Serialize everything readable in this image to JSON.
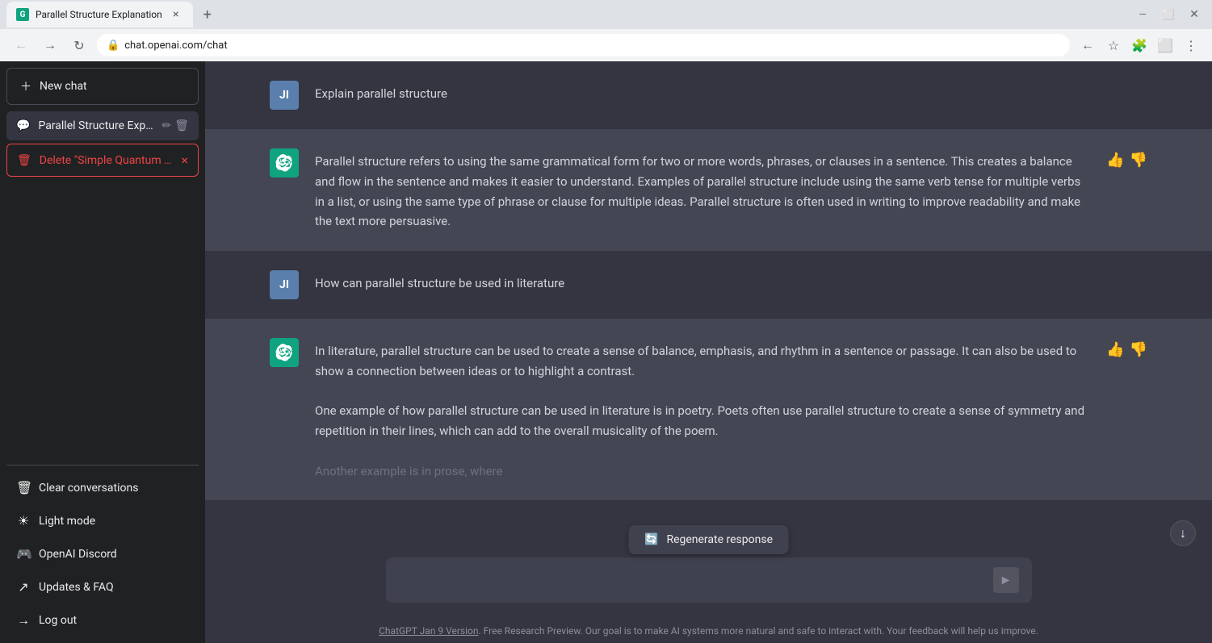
{
  "browser": {
    "tab_title": "Parallel Structure Explanation",
    "url": "chat.openai.com/chat"
  },
  "sidebar": {
    "new_chat_label": "New chat",
    "chat_history": [
      {
        "id": "parallel-structure",
        "title": "Parallel Structure Expla",
        "active": true
      }
    ],
    "delete_item": {
      "label": "Delete \"Simple Quantum Com",
      "close_icon": "×"
    },
    "bottom_items": [
      {
        "id": "clear",
        "icon": "🗑",
        "label": "Clear conversations"
      },
      {
        "id": "light-mode",
        "icon": "☀",
        "label": "Light mode"
      },
      {
        "id": "discord",
        "icon": "🎮",
        "label": "OpenAI Discord"
      },
      {
        "id": "faq",
        "icon": "↗",
        "label": "Updates & FAQ"
      },
      {
        "id": "logout",
        "icon": "→",
        "label": "Log out"
      }
    ]
  },
  "messages": [
    {
      "id": "msg1",
      "role": "user",
      "avatar_initials": "JI",
      "content": "Explain parallel structure"
    },
    {
      "id": "msg2",
      "role": "ai",
      "content": "Parallel structure refers to using the same grammatical form for two or more words, phrases, or clauses in a sentence. This creates a balance and flow in the sentence and makes it easier to understand. Examples of parallel structure include using the same verb tense for multiple verbs in a list, or using the same type of phrase or clause for multiple ideas. Parallel structure is often used in writing to improve readability and make the text more persuasive."
    },
    {
      "id": "msg3",
      "role": "user",
      "avatar_initials": "JI",
      "content": "How can parallel structure be used in literature"
    },
    {
      "id": "msg4",
      "role": "ai",
      "content_parts": [
        "In literature, parallel structure can be used to create a sense of balance, emphasis, and rhythm in a sentence or passage. It can also be used to show a connection between ideas or to highlight a contrast.",
        "One example of how parallel structure can be used in literature is in poetry. Poets often use parallel structure to create a sense of symmetry and repetition in their lines, which can add to the overall musicality of the poem.",
        "Another example is in prose, where"
      ],
      "content_truncated": true
    }
  ],
  "input": {
    "placeholder": "",
    "value": ""
  },
  "regenerate_btn": "Regenerate response",
  "footer": {
    "link_text": "ChatGPT Jan 9 Version",
    "text": ". Free Research Preview. Our goal is to make AI systems more natural and safe to interact with. Your feedback will help us improve."
  }
}
